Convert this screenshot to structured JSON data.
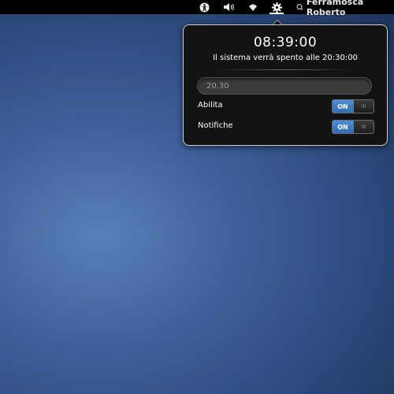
{
  "topbar": {
    "icons": [
      "accessibility-icon",
      "volume-icon",
      "wifi-icon",
      "gear-icon"
    ],
    "user_name": "Ferramosca Roberto",
    "user_status_icon": "status-icon"
  },
  "popup": {
    "clock": "08:39:00",
    "subtitle": "Il sistema verrà spento alle 20:30:00",
    "time_input_value": "20.30",
    "rows": [
      {
        "label": "Abilita",
        "switch_on_label": "ON",
        "switch_handle": "III",
        "state": true
      },
      {
        "label": "Notifiche",
        "switch_on_label": "ON",
        "switch_handle": "III",
        "state": true
      }
    ]
  },
  "colors": {
    "topbar": "#000000",
    "popup_bg": "#131313",
    "switch_on": "#3d7fc9",
    "desktop": "#3d5f99"
  }
}
